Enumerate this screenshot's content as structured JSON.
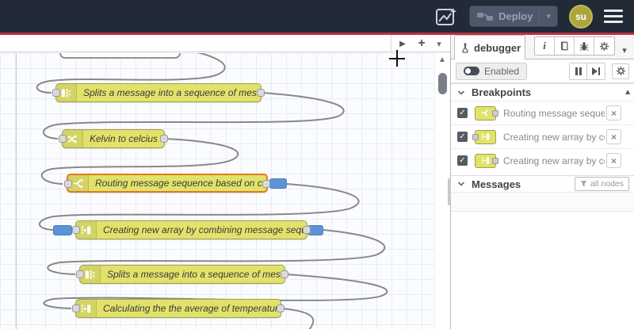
{
  "header": {
    "deploy_label": "Deploy",
    "avatar_text": "su"
  },
  "icons": {
    "close": "×",
    "check": "✓",
    "scroll_up": "▲",
    "tab_scroll_right": "▶",
    "add_flow": "+",
    "caret_down": "▾",
    "info": "i"
  },
  "canvas": {
    "nodes": [
      {
        "type": "split",
        "label": "Splits a message into a sequence of messages."
      },
      {
        "type": "change",
        "label": "Kelvin to celcius"
      },
      {
        "type": "switch",
        "label": "Routing message sequence based on condition",
        "highlighted": true,
        "breakpoint_output": true
      },
      {
        "type": "join",
        "label": "Creating new array by combining message sequence",
        "breakpoint_input": true,
        "breakpoint_output": true
      },
      {
        "type": "split",
        "label": "Splits a message into a sequence of messages."
      },
      {
        "type": "join",
        "label": "Calculating the the average of temperature"
      }
    ]
  },
  "sidebar": {
    "tab_label": "debugger",
    "enabled_label": "Enabled",
    "breakpoints": {
      "title": "Breakpoints",
      "items": [
        {
          "checked": true,
          "node_type": "switch",
          "label": "Routing message sequence based on condition"
        },
        {
          "checked": true,
          "node_type": "join",
          "label": "Creating new array by combining message sequence"
        },
        {
          "checked": true,
          "node_type": "join",
          "label": "Creating new array by combining message sequence"
        }
      ]
    },
    "messages": {
      "title": "Messages",
      "filter_label": "all nodes"
    }
  }
}
